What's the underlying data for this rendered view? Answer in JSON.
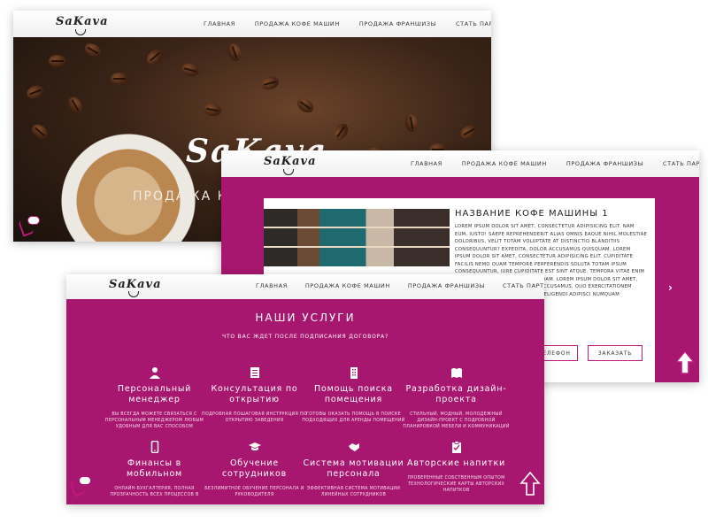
{
  "colors": {
    "accent": "#a8176f",
    "accent_line": "#c2187b",
    "dark_hero": "#2a1b12"
  },
  "logo": {
    "text": "SaKava"
  },
  "nav": {
    "items": [
      "Главная",
      "Продажа кофе машин",
      "Продажа франшизы",
      "Стать партнером"
    ]
  },
  "screen1": {
    "brand": "SaKava",
    "subtitle": "ПРОДАЖА КОФЕ"
  },
  "screen2": {
    "product_title": "НАЗВАНИЕ КОФЕ МАШИНЫ 1",
    "description": "Lorem ipsum dolor sit amet, consectetur adipisicing elit. Nam eum, iusto! Saepe reprehenderit alias omnis eaque nihil molestiae doloribus, velit totam voluptate at distinctio blanditiis consequuntur? Expedita, dolor accusamus quisquam. Lorem ipsum dolor sit amet, consectetur adipisicing elit. Cupiditate facilis nemo quam tempore perferendis soluta totam ipsum consequuntur, iure cupiditate est sint atque. Tempora vitae enim facilis numquam eaque quibusdam. Lorem ipsum dolor sit amet, consectetur adipisicing elit. Accusamus, quo exercitationem aspernatur eaque perspiciatis eligendi adipisci numquam consequatur quia id, dolorum.",
    "phone_button": "...елефон",
    "order_button": "Заказать",
    "next_arrow": "›"
  },
  "screen3": {
    "heading": "Наши услуги",
    "question": "Что вас ждет после подписания договора?",
    "services": [
      {
        "icon": "person-icon",
        "title": "Персональный менеджер",
        "desc": "Вы всегда можете связаться с персональным менеджером любым удобным для вас способом"
      },
      {
        "icon": "document-icon",
        "title": "Консультация по открытию",
        "desc": "Подробная пошаговая инструкция по открытию заведения"
      },
      {
        "icon": "building-icon",
        "title": "Помощь поиска помещения",
        "desc": "Готовы оказать помощь в поиске подходящих для аренды помещений"
      },
      {
        "icon": "book-icon",
        "title": "Разработка дизайн-проекта",
        "desc": "Стильный, модный, молодежный дизайн-проект с подробной планировкой мебели и коммуникаций"
      },
      {
        "icon": "mobile-icon",
        "title": "Финансы в мобильном",
        "desc": "Онлайн-бухгалтерия, полная прозрачность всех процессов в"
      },
      {
        "icon": "graduation-cap-icon",
        "title": "Обучение сотрудников",
        "desc": "Безлимитное обучение персонала и руководителя"
      },
      {
        "icon": "handshake-icon",
        "title": "Система мотивации персонала",
        "desc": "Эффективная система мотивации линейных сотрудников"
      },
      {
        "icon": "clipboard-check-icon",
        "title": "Авторские напитки",
        "desc": "Проверенные собственным опытом технологические карты авторских напитков"
      }
    ]
  }
}
